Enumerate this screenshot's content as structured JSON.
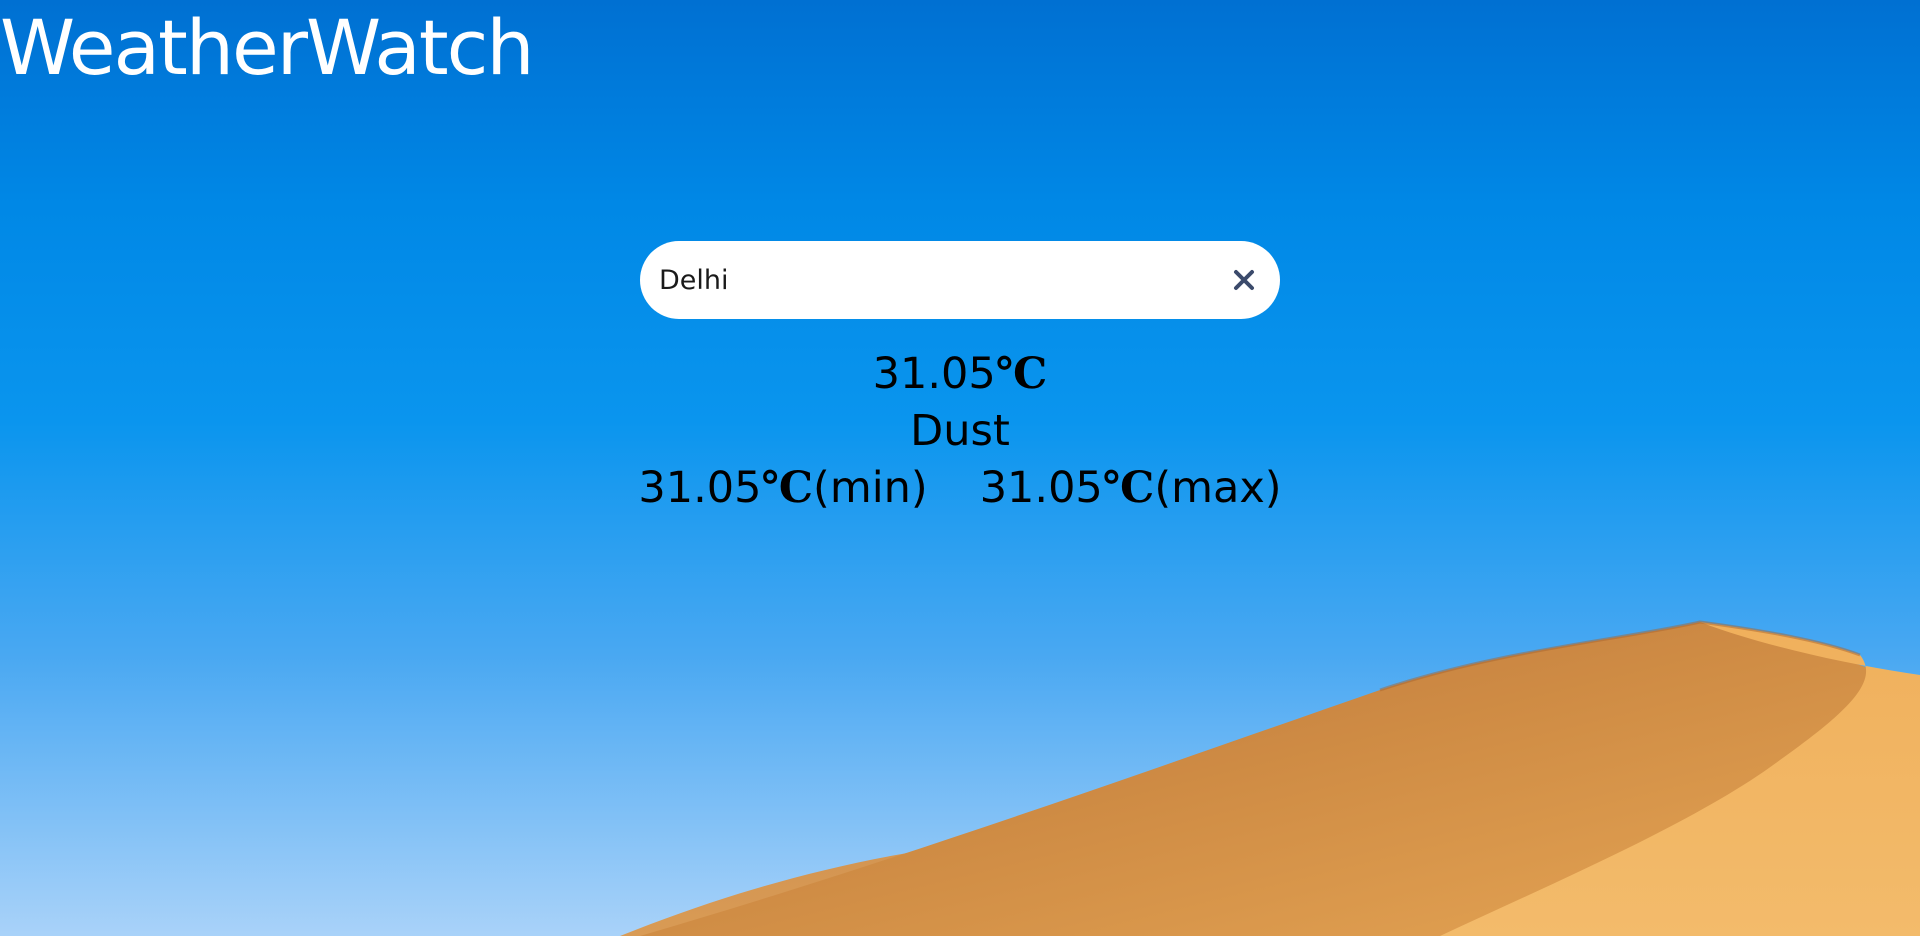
{
  "header": {
    "title": "WeatherWatch"
  },
  "search": {
    "value": "Delhi",
    "placeholder": "",
    "clear_icon": "close-icon"
  },
  "weather": {
    "temperature": "31.05",
    "unit": "℃",
    "condition": "Dust",
    "min_value": "31.05",
    "min_suffix": "(min)",
    "max_value": "31.05",
    "max_suffix": "(max)"
  },
  "colors": {
    "sky_top": "#0070d2",
    "sky_bottom": "#a9d2f9",
    "sand": "#e0a14f",
    "title_text": "#ffffff",
    "info_text": "#000000",
    "clear_icon": "#3b4a6b"
  }
}
